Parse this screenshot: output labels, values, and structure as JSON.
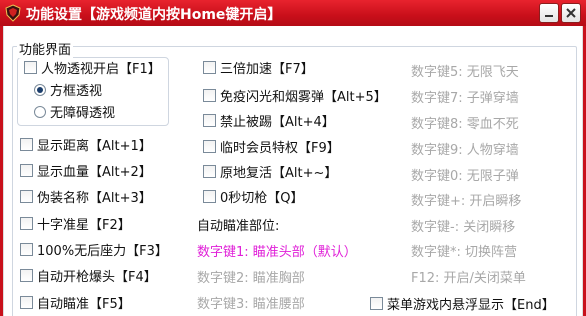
{
  "window": {
    "title": "功能设置【游戏频道内按Home键开启】"
  },
  "group_title": "功能界面",
  "col1": [
    {
      "label": "人物透视开启【F1】",
      "checked": false
    },
    {
      "label": "显示距离【Alt+1】",
      "checked": false
    },
    {
      "label": "显示血量【Alt+2】",
      "checked": false
    },
    {
      "label": "伪装名称【Alt+3】",
      "checked": false
    },
    {
      "label": "十字准星【F2】",
      "checked": false
    },
    {
      "label": "100%无后座力【F3】",
      "checked": false
    },
    {
      "label": "自动开枪爆头【F4】",
      "checked": false
    },
    {
      "label": "自动瞄准【F5】",
      "checked": false
    }
  ],
  "radios": [
    {
      "label": "方框透视",
      "selected": true
    },
    {
      "label": "无障碍透视",
      "selected": false
    }
  ],
  "col2": [
    {
      "label": "三倍加速【F7】",
      "checked": false
    },
    {
      "label": "免疫闪光和烟雾弹【Alt+5】",
      "checked": false
    },
    {
      "label": "禁止被踢【Alt+4】",
      "checked": false
    },
    {
      "label": "临时会员特权【F9】",
      "checked": false
    },
    {
      "label": "原地复活【Alt+~】",
      "checked": false
    },
    {
      "label": "0秒切枪【Q】",
      "checked": false
    }
  ],
  "aim": {
    "label": "自动瞄准部位:",
    "options": [
      "数字键1: 瞄准头部（默认）",
      "数字键2: 瞄准胸部",
      "数字键3: 瞄准腰部"
    ]
  },
  "col3": [
    "数字键5: 无限飞天",
    "数字键7: 子弹穿墙",
    "数字键8: 零血不死",
    "数字键9: 人物穿墙",
    "数字键0: 无限子弹",
    "数字键+: 开启瞬移",
    "数字键-: 关闭瞬移",
    "数字键*: 切换阵营",
    "F12: 开启/关闭菜单"
  ],
  "floating": {
    "label": "菜单游戏内悬浮显示【End】",
    "checked": false
  },
  "colors": {
    "titlebar": "#c90f1a",
    "accent": "#e020d8",
    "disabled": "#a8a8a8"
  }
}
